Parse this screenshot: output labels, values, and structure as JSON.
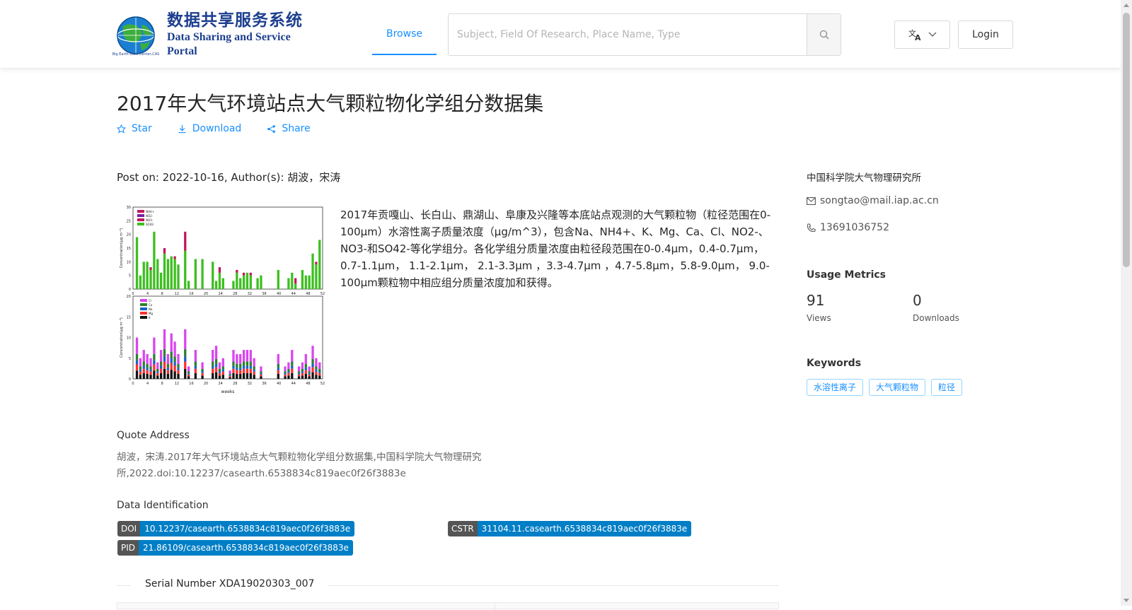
{
  "header": {
    "logo_cn": "数据共享服务系统",
    "logo_en": "Data Sharing and Service Portal",
    "logo_ring_text": "地球大数据科学数据中心",
    "nav_browse": "Browse",
    "search_placeholder": "Subject, Field Of Research, Place Name, Type",
    "login": "Login",
    "language_icon": "translate-icon"
  },
  "dataset": {
    "title": "2017年大气环境站点大气颗粒物化学组分数据集",
    "actions": {
      "star": "Star",
      "download": "Download",
      "share": "Share"
    },
    "post_info": "Post on: 2022-10-16, Author(s): 胡波，宋涛",
    "description": "2017年贡嘎山、长白山、鼎湖山、阜康及兴隆等本底站点观测的大气颗粒物（粒径范围在0-100μm）水溶性离子质量浓度（μg/m^3），包含Na、NH4+、K、Mg、Ca、Cl、NO2-、NO3-和SO42-等化学组分。各化学组分质量浓度由粒径段范围在0-0.4μm，0.4-0.7μm， 0.7-1.1μm， 1.1-2.1μm， 2.1-3.3μm ，3.3-4.7μm ，4.7-5.8μm，5.8-9.0μm， 9.0-100μm颗粒物中相应组分质量浓度加和获得。",
    "quote_label": "Quote Address",
    "quote_text": "胡波，宋涛.2017年大气环境站点大气颗粒物化学组分数据集,中国科学院大气物理研究所,2022.doi:10.12237/casearth.6538834c819aec0f26f3883e",
    "ident_label": "Data Identification",
    "doi_key": "DOI",
    "doi_value": "10.12237/casearth.6538834c819aec0f26f3883e",
    "cstr_key": "CSTR",
    "cstr_value": "31104.11.casearth.6538834c819aec0f26f3883e",
    "pid_key": "PID",
    "pid_value": "21.86109/casearth.6538834c819aec0f26f3883e",
    "serial": "Serial Number XDA19020303_007"
  },
  "sidebar": {
    "institution": "中国科学院大气物理研究所",
    "email": "songtao@mail.iap.ac.cn",
    "phone": "13691036752",
    "metrics_label": "Usage Metrics",
    "views": "91",
    "views_label": "Views",
    "downloads": "0",
    "downloads_label": "Downloads",
    "keywords_label": "Keywords",
    "keywords": [
      "水溶性离子",
      "大气颗粒物",
      "粒径"
    ]
  },
  "thumbnail": {
    "top_ylabel": "Concentration(μg m⁻³)",
    "bottom_ylabel": "Concentration(μg m⁻³)",
    "xlabel": "weeks",
    "x_ticks": [
      "0",
      "4",
      "8",
      "12",
      "16",
      "20",
      "24",
      "28",
      "32",
      "36",
      "40",
      "44",
      "48",
      "52"
    ],
    "top_y_ticks": [
      "0",
      "5",
      "10",
      "15",
      "20",
      "25",
      "30"
    ],
    "bottom_y_ticks": [
      "0",
      "5",
      "10",
      "15",
      "20"
    ],
    "top_legend": [
      "NH4+",
      "NO2-",
      "NO3-",
      "SO42-"
    ],
    "bottom_legend": [
      "Cl",
      "Ca",
      "Na",
      "Mg",
      "K"
    ],
    "colors": {
      "sulfate": "#3cbf1f",
      "nitrate": "#c2185b",
      "chloride": "#d946ef",
      "k": "#111111",
      "na": "#1565c0",
      "mg": "#2e7d32",
      "ca": "#ff3030"
    }
  }
}
